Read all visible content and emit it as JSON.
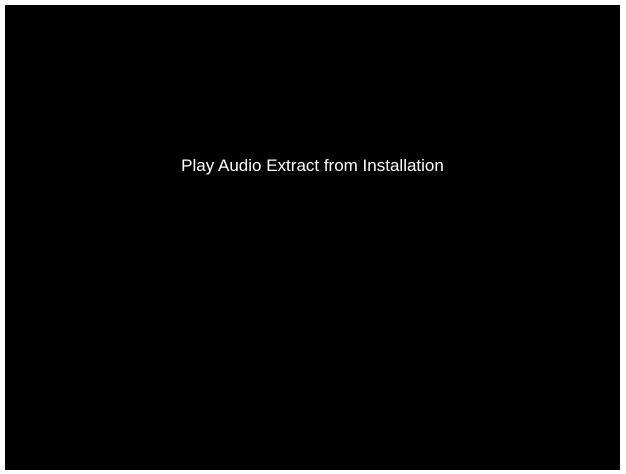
{
  "player": {
    "play_label": "Play Audio Extract from Installation"
  },
  "colors": {
    "background": "#000000",
    "text": "#ffffff"
  }
}
